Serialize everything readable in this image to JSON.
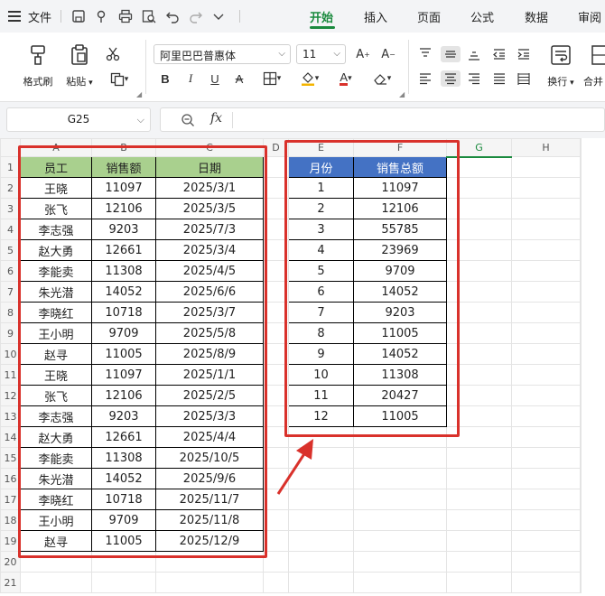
{
  "menubar": {
    "file_label": "文件",
    "tabs": [
      {
        "label": "开始",
        "active": true
      },
      {
        "label": "插入",
        "active": false
      },
      {
        "label": "页面",
        "active": false
      },
      {
        "label": "公式",
        "active": false
      },
      {
        "label": "数据",
        "active": false
      },
      {
        "label": "审阅",
        "active": false
      }
    ],
    "accent_color": "#1a8a3e"
  },
  "ribbon": {
    "format_painter_label": "格式刷",
    "paste_label": "粘贴",
    "font_name": "阿里巴巴普惠体",
    "font_size": "11",
    "wrap_label": "换行",
    "merge_label": "合并"
  },
  "formula_bar": {
    "cell_ref": "G25",
    "fx_label": "fx",
    "formula": ""
  },
  "sheet": {
    "columns": [
      "A",
      "B",
      "C",
      "D",
      "E",
      "F",
      "G",
      "H"
    ],
    "selected_column": "G",
    "rows": [
      "1",
      "2",
      "3",
      "4",
      "5",
      "6",
      "7",
      "8",
      "9",
      "10",
      "11",
      "12",
      "13",
      "14",
      "15",
      "16",
      "17",
      "18",
      "19",
      "20",
      "21"
    ],
    "table1": {
      "headers": [
        "员工",
        "销售额",
        "日期"
      ],
      "header_color": "#a9d08e",
      "records": [
        [
          "王晓",
          "11097",
          "2025/3/1"
        ],
        [
          "张飞",
          "12106",
          "2025/3/5"
        ],
        [
          "李志强",
          "9203",
          "2025/7/3"
        ],
        [
          "赵大勇",
          "12661",
          "2025/3/4"
        ],
        [
          "李能卖",
          "11308",
          "2025/4/5"
        ],
        [
          "朱光潜",
          "14052",
          "2025/6/6"
        ],
        [
          "李晓红",
          "10718",
          "2025/3/7"
        ],
        [
          "王小明",
          "9709",
          "2025/5/8"
        ],
        [
          "赵寻",
          "11005",
          "2025/8/9"
        ],
        [
          "王晓",
          "11097",
          "2025/1/1"
        ],
        [
          "张飞",
          "12106",
          "2025/2/5"
        ],
        [
          "李志强",
          "9203",
          "2025/3/3"
        ],
        [
          "赵大勇",
          "12661",
          "2025/4/4"
        ],
        [
          "李能卖",
          "11308",
          "2025/10/5"
        ],
        [
          "朱光潜",
          "14052",
          "2025/9/6"
        ],
        [
          "李晓红",
          "10718",
          "2025/11/7"
        ],
        [
          "王小明",
          "9709",
          "2025/11/8"
        ],
        [
          "赵寻",
          "11005",
          "2025/12/9"
        ]
      ]
    },
    "table2": {
      "headers": [
        "月份",
        "销售总额"
      ],
      "header_color": "#4472c4",
      "records": [
        [
          "1",
          "11097"
        ],
        [
          "2",
          "12106"
        ],
        [
          "3",
          "55785"
        ],
        [
          "4",
          "23969"
        ],
        [
          "5",
          "9709"
        ],
        [
          "6",
          "14052"
        ],
        [
          "7",
          "9203"
        ],
        [
          "8",
          "11005"
        ],
        [
          "9",
          "14052"
        ],
        [
          "10",
          "11308"
        ],
        [
          "11",
          "20427"
        ],
        [
          "12",
          "11005"
        ]
      ]
    },
    "annotation_color": "#d9312b"
  }
}
